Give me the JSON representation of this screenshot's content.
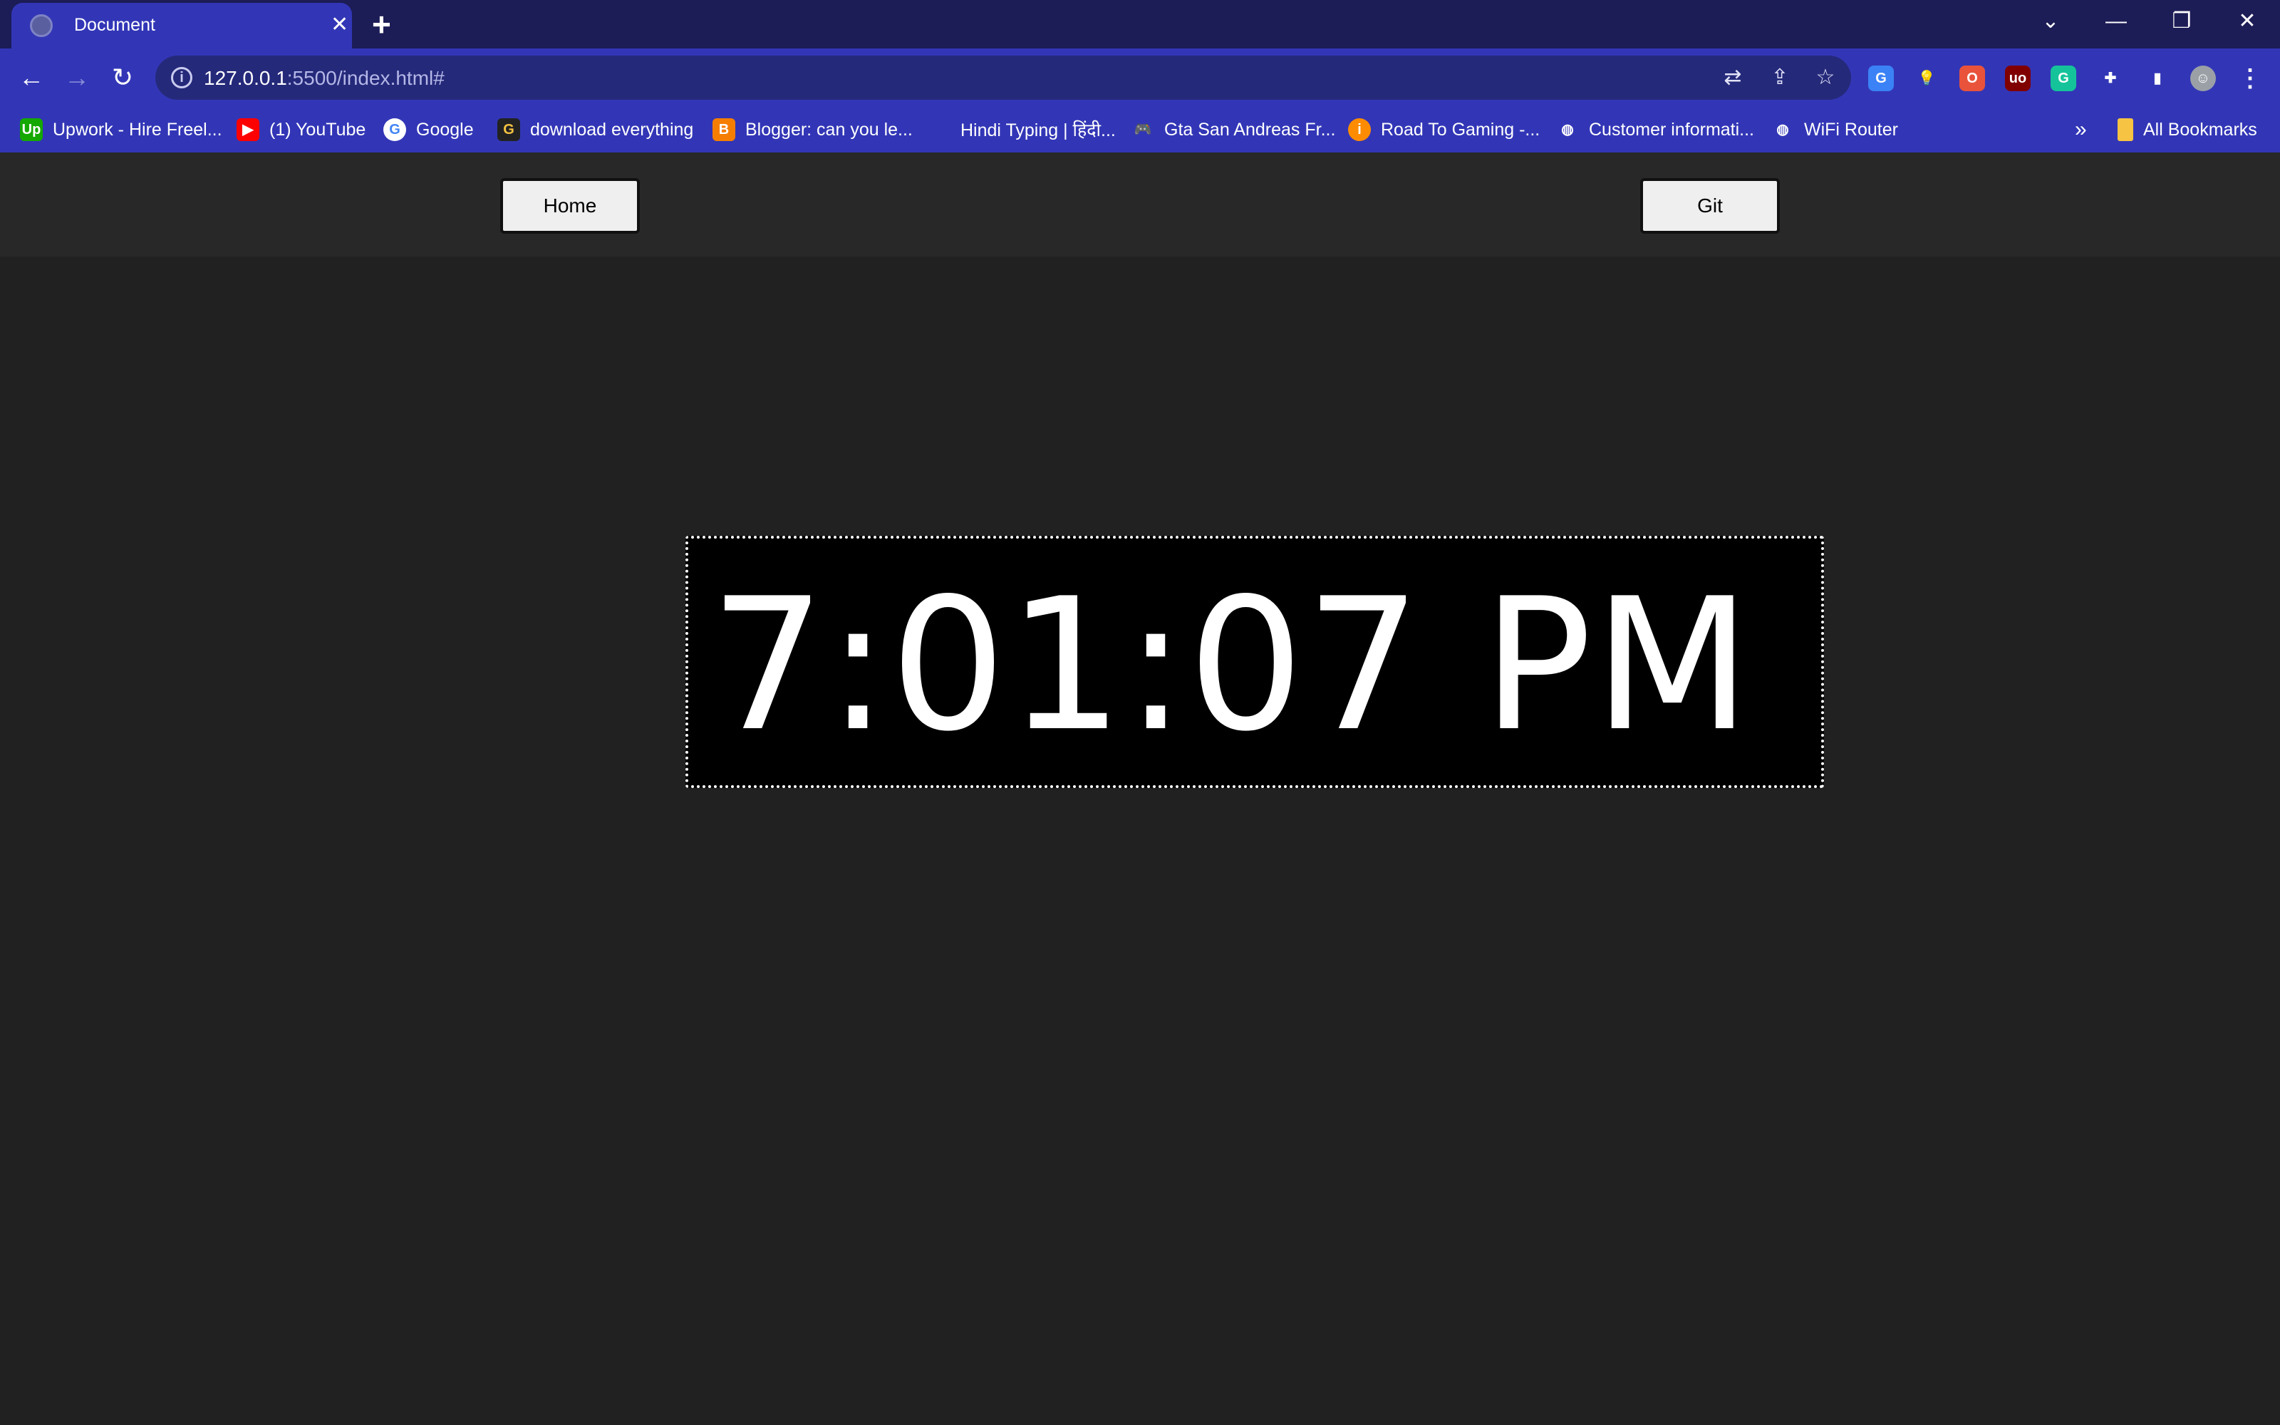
{
  "browser": {
    "tab": {
      "title": "Document",
      "close_glyph": "✕"
    },
    "new_tab_glyph": "+",
    "window_controls": {
      "dropdown": "⌄",
      "minimize": "—",
      "restore": "❐",
      "close": "✕"
    },
    "toolbar": {
      "back_glyph": "←",
      "forward_glyph": "→",
      "reload_glyph": "↻",
      "url_host": "127.0.0.1",
      "url_rest": ":5500/index.html#",
      "info_glyph": "i",
      "translate_glyph": "⇄",
      "share_glyph": "⇪",
      "star_glyph": "☆",
      "extensions": [
        {
          "name": "translate-ext-icon",
          "glyph": "G",
          "color": "#3b82f6"
        },
        {
          "name": "bulb-ext-icon",
          "glyph": "💡",
          "color": "#3236b6"
        },
        {
          "name": "opera-ext-icon",
          "glyph": "O",
          "color": "#e9533b"
        },
        {
          "name": "ublock-ext-icon",
          "glyph": "uo",
          "color": "#800000"
        },
        {
          "name": "grammarly-ext-icon",
          "glyph": "G",
          "color": "#15c39a"
        },
        {
          "name": "puzzle-ext-icon",
          "glyph": "✚",
          "color": "#3236b6"
        },
        {
          "name": "sidepanel-icon",
          "glyph": "▮",
          "color": "#3236b6"
        },
        {
          "name": "profile-avatar-icon",
          "glyph": "☺",
          "color": "#9aa0a6"
        },
        {
          "name": "menu-icon",
          "glyph": "⋮",
          "color": "#3236b6"
        }
      ]
    },
    "bookmarks": [
      {
        "label": "Upwork - Hire Freel...",
        "icon": "upwork-icon",
        "glyph": "Up",
        "color": "#14a800"
      },
      {
        "label": "(1) YouTube",
        "icon": "youtube-icon",
        "glyph": "▶",
        "color": "#ff0000"
      },
      {
        "label": "Google",
        "icon": "google-icon",
        "glyph": "G",
        "color": "#ffffff"
      },
      {
        "label": "download everything",
        "icon": "download-g-icon",
        "glyph": "G",
        "color": "#222222"
      },
      {
        "label": "Blogger: can you le...",
        "icon": "blogger-icon",
        "glyph": "B",
        "color": "#f57d00"
      },
      {
        "label": "Hindi Typing | हिंदी...",
        "icon": "none",
        "glyph": "",
        "color": "#3236b6"
      },
      {
        "label": "Gta San Andreas Fr...",
        "icon": "gamepad-icon",
        "glyph": "🎮",
        "color": "#3236b6"
      },
      {
        "label": "Road To Gaming -...",
        "icon": "info-orange-icon",
        "glyph": "i",
        "color": "#ff8c00"
      },
      {
        "label": "Customer informati...",
        "icon": "globe-icon",
        "glyph": "◍",
        "color": "#3236b6"
      },
      {
        "label": "WiFi Router",
        "icon": "globe-icon",
        "glyph": "◍",
        "color": "#3236b6"
      }
    ],
    "more_bookmarks_glyph": "»",
    "all_bookmarks": {
      "label": "All Bookmarks",
      "glyph": "▮",
      "color": "#f6c342"
    }
  },
  "page": {
    "home_label": "Home",
    "git_label": "Git",
    "clock_time": "7:01:07 PM"
  }
}
